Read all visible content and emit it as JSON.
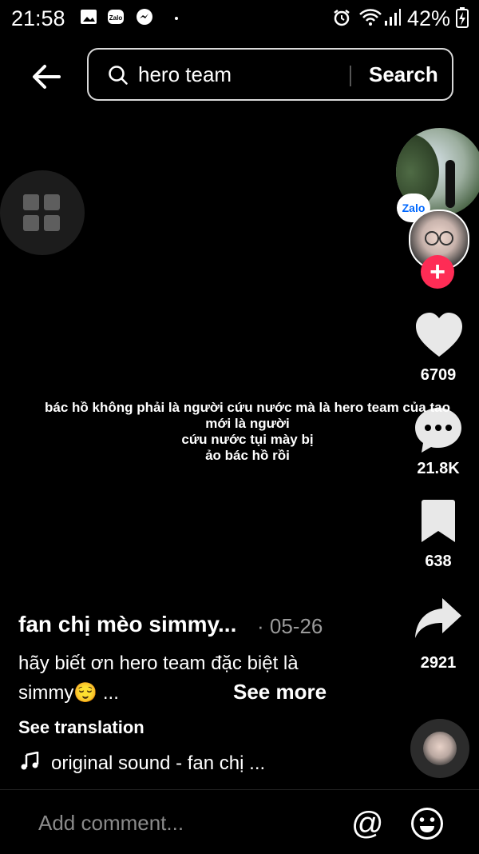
{
  "status_bar": {
    "time": "21:58",
    "battery": "42%",
    "left_icons": [
      "image-icon",
      "zalo-icon",
      "messenger-icon",
      "dot-icon"
    ],
    "right_icons": [
      "alarm-icon",
      "wifi-icon",
      "signal-icon",
      "battery-charging-icon"
    ]
  },
  "search": {
    "query": "hero team",
    "button_label": "Search"
  },
  "actions": {
    "likes": "6709",
    "comments": "21.8K",
    "bookmarks": "638",
    "shares": "2921",
    "zalo_badge": "Zalo",
    "follow_symbol": "+"
  },
  "video_overlay": {
    "lines": [
      "bác hồ không phải là người cứu nước mà là hero team của tao",
      "mới là người",
      "cứu nước tụi mày bị",
      "ảo bác hồ rồi"
    ]
  },
  "post": {
    "author": "fan chị mèo simmy...",
    "date": "· 05-26",
    "caption_line1": "hãy biết ơn hero team đặc biệt là",
    "caption_line2": "simmy😌 ...",
    "see_more": "See more",
    "see_translation": "See translation",
    "sound": "original sound - fan chị ..."
  },
  "comment_bar": {
    "placeholder": "Add comment...",
    "mention_symbol": "@"
  }
}
